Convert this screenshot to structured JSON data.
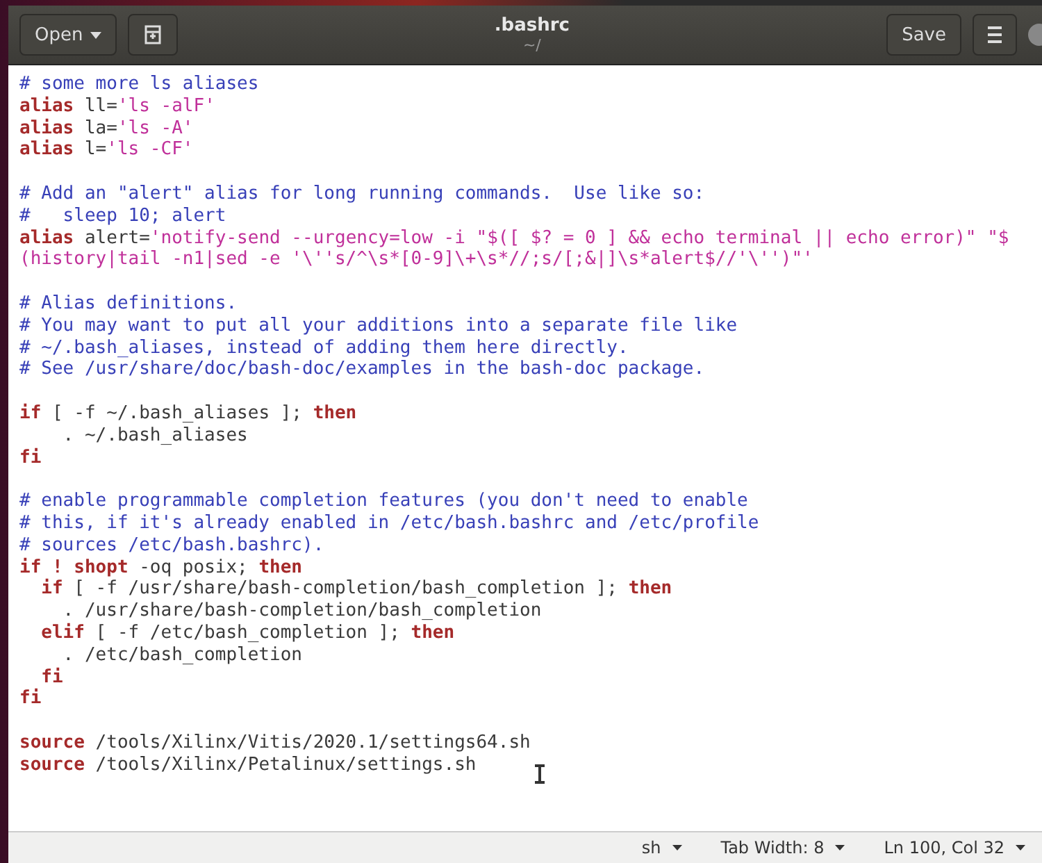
{
  "window": {
    "title": ".bashrc",
    "subtitle": "~/"
  },
  "header": {
    "open_button": "Open",
    "save_button": "Save"
  },
  "lines": [
    {
      "kind": "code",
      "segments": [
        {
          "kind": "comment",
          "text": "# some more ls aliases"
        }
      ]
    },
    {
      "kind": "code",
      "segments": [
        {
          "kind": "keyword",
          "text": "alias"
        },
        {
          "kind": "plain",
          "text": " ll="
        },
        {
          "kind": "string",
          "text": "'ls -alF'"
        }
      ]
    },
    {
      "kind": "code",
      "segments": [
        {
          "kind": "keyword",
          "text": "alias"
        },
        {
          "kind": "plain",
          "text": " la="
        },
        {
          "kind": "string",
          "text": "'ls -A'"
        }
      ]
    },
    {
      "kind": "code",
      "segments": [
        {
          "kind": "keyword",
          "text": "alias"
        },
        {
          "kind": "plain",
          "text": " l="
        },
        {
          "kind": "string",
          "text": "'ls -CF'"
        }
      ]
    },
    {
      "kind": "blank"
    },
    {
      "kind": "code",
      "segments": [
        {
          "kind": "comment",
          "text": "# Add an \"alert\" alias for long running commands.  Use like so:"
        }
      ]
    },
    {
      "kind": "code",
      "segments": [
        {
          "kind": "comment",
          "text": "#   sleep 10; alert"
        }
      ]
    },
    {
      "kind": "code",
      "segments": [
        {
          "kind": "keyword",
          "text": "alias"
        },
        {
          "kind": "plain",
          "text": " alert="
        },
        {
          "kind": "string",
          "text": "'notify-send --urgency=low -i \"$([ $? = 0 ] && echo terminal || echo error)\" \"$"
        }
      ]
    },
    {
      "kind": "code",
      "segments": [
        {
          "kind": "string",
          "text": "(history|tail -n1|sed -e '\\''s/^\\s*[0-9]\\+\\s*//;s/[;&|]\\s*alert$//'\\'')\"'"
        }
      ]
    },
    {
      "kind": "blank"
    },
    {
      "kind": "code",
      "segments": [
        {
          "kind": "comment",
          "text": "# Alias definitions."
        }
      ]
    },
    {
      "kind": "code",
      "segments": [
        {
          "kind": "comment",
          "text": "# You may want to put all your additions into a separate file like"
        }
      ]
    },
    {
      "kind": "code",
      "segments": [
        {
          "kind": "comment",
          "text": "# ~/.bash_aliases, instead of adding them here directly."
        }
      ]
    },
    {
      "kind": "code",
      "segments": [
        {
          "kind": "comment",
          "text": "# See /usr/share/doc/bash-doc/examples in the bash-doc package."
        }
      ]
    },
    {
      "kind": "blank"
    },
    {
      "kind": "code",
      "segments": [
        {
          "kind": "keyword",
          "text": "if"
        },
        {
          "kind": "plain",
          "text": " [ -f ~/.bash_aliases ]; "
        },
        {
          "kind": "keyword",
          "text": "then"
        }
      ]
    },
    {
      "kind": "code",
      "segments": [
        {
          "kind": "plain",
          "text": "    . ~/.bash_aliases"
        }
      ]
    },
    {
      "kind": "code",
      "segments": [
        {
          "kind": "keyword",
          "text": "fi"
        }
      ]
    },
    {
      "kind": "blank"
    },
    {
      "kind": "code",
      "segments": [
        {
          "kind": "comment",
          "text": "# enable programmable completion features (you don't need to enable"
        }
      ]
    },
    {
      "kind": "code",
      "segments": [
        {
          "kind": "comment",
          "text": "# this, if it's already enabled in /etc/bash.bashrc and /etc/profile"
        }
      ]
    },
    {
      "kind": "code",
      "segments": [
        {
          "kind": "comment",
          "text": "# sources /etc/bash.bashrc)."
        }
      ]
    },
    {
      "kind": "code",
      "segments": [
        {
          "kind": "keyword",
          "text": "if ! shopt"
        },
        {
          "kind": "plain",
          "text": " -oq posix; "
        },
        {
          "kind": "keyword",
          "text": "then"
        }
      ]
    },
    {
      "kind": "code",
      "segments": [
        {
          "kind": "keyword",
          "text": "  if"
        },
        {
          "kind": "plain",
          "text": " [ -f /usr/share/bash-completion/bash_completion ]; "
        },
        {
          "kind": "keyword",
          "text": "then"
        }
      ]
    },
    {
      "kind": "code",
      "segments": [
        {
          "kind": "plain",
          "text": "    . /usr/share/bash-completion/bash_completion"
        }
      ]
    },
    {
      "kind": "code",
      "segments": [
        {
          "kind": "keyword",
          "text": "  elif"
        },
        {
          "kind": "plain",
          "text": " [ -f /etc/bash_completion ]; "
        },
        {
          "kind": "keyword",
          "text": "then"
        }
      ]
    },
    {
      "kind": "code",
      "segments": [
        {
          "kind": "plain",
          "text": "    . /etc/bash_completion"
        }
      ]
    },
    {
      "kind": "code",
      "segments": [
        {
          "kind": "keyword",
          "text": "  fi"
        }
      ]
    },
    {
      "kind": "code",
      "segments": [
        {
          "kind": "keyword",
          "text": "fi"
        }
      ]
    },
    {
      "kind": "blank"
    },
    {
      "kind": "code",
      "segments": [
        {
          "kind": "keyword",
          "text": "source"
        },
        {
          "kind": "plain",
          "text": " /tools/Xilinx/Vitis/2020.1/settings64.sh"
        }
      ]
    },
    {
      "kind": "code",
      "segments": [
        {
          "kind": "keyword",
          "text": "source"
        },
        {
          "kind": "plain",
          "text": " /tools/Xilinx/Petalinux/settings.sh"
        }
      ]
    }
  ],
  "status_bar": [
    {
      "label": "sh"
    },
    {
      "label": "Tab Width: 8"
    },
    {
      "label": "Ln 100, Col 32"
    }
  ]
}
